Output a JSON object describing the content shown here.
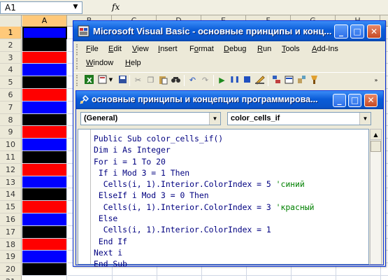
{
  "excel": {
    "name_box": "A1",
    "fx_label": "fx",
    "columns": [
      "A",
      "B",
      "C",
      "D",
      "E",
      "F",
      "G",
      "H"
    ],
    "rows": [
      {
        "num": "1",
        "color": "#0000ff"
      },
      {
        "num": "2",
        "color": "#000000"
      },
      {
        "num": "3",
        "color": "#ff0000"
      },
      {
        "num": "4",
        "color": "#0000ff"
      },
      {
        "num": "5",
        "color": "#000000"
      },
      {
        "num": "6",
        "color": "#ff0000"
      },
      {
        "num": "7",
        "color": "#0000ff"
      },
      {
        "num": "8",
        "color": "#000000"
      },
      {
        "num": "9",
        "color": "#ff0000"
      },
      {
        "num": "10",
        "color": "#0000ff"
      },
      {
        "num": "11",
        "color": "#000000"
      },
      {
        "num": "12",
        "color": "#ff0000"
      },
      {
        "num": "13",
        "color": "#0000ff"
      },
      {
        "num": "14",
        "color": "#000000"
      },
      {
        "num": "15",
        "color": "#ff0000"
      },
      {
        "num": "16",
        "color": "#0000ff"
      },
      {
        "num": "17",
        "color": "#000000"
      },
      {
        "num": "18",
        "color": "#ff0000"
      },
      {
        "num": "19",
        "color": "#0000ff"
      },
      {
        "num": "20",
        "color": "#000000"
      },
      {
        "num": "21",
        "color": "#ffffff"
      }
    ]
  },
  "vbe": {
    "title": "Microsoft Visual Basic - основные принципы и конц...",
    "menu_row1": [
      "File",
      "Edit",
      "View",
      "Insert",
      "Format",
      "Debug",
      "Run",
      "Tools",
      "Add-Ins"
    ],
    "menu_row2": [
      "Window",
      "Help"
    ],
    "controls": {
      "minimize": "_",
      "maximize": "□",
      "close": "✕"
    }
  },
  "code_window": {
    "title": "основные принципы и концепции программирова...",
    "object_combo": "(General)",
    "proc_combo": "color_cells_if",
    "lines": [
      {
        "code": "Public Sub color_cells_if()",
        "comment": ""
      },
      {
        "code": "Dim i As Integer",
        "comment": ""
      },
      {
        "code": "For i = 1 To 20",
        "comment": ""
      },
      {
        "code": " If i Mod 3 = 1 Then",
        "comment": ""
      },
      {
        "code": "  Cells(i, 1).Interior.ColorIndex = 5 ",
        "comment": "'синий"
      },
      {
        "code": " ElseIf i Mod 3 = 0 Then",
        "comment": ""
      },
      {
        "code": "  Cells(i, 1).Interior.ColorIndex = 3 ",
        "comment": "'красный"
      },
      {
        "code": " Else",
        "comment": ""
      },
      {
        "code": "  Cells(i, 1).Interior.ColorIndex = 1",
        "comment": ""
      },
      {
        "code": " End If",
        "comment": ""
      },
      {
        "code": "Next i",
        "comment": ""
      },
      {
        "code": "End Sub",
        "comment": ""
      }
    ]
  }
}
